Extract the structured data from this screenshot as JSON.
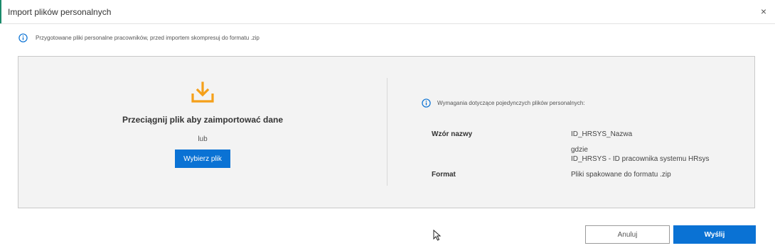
{
  "dialog": {
    "title": "Import plików personalnych",
    "close_label": "×"
  },
  "info": {
    "icon": "info-circle-icon",
    "text": "Przygotowane pliki personalne pracowników, przed importem skompresuj do formatu .zip"
  },
  "drop_zone": {
    "icon": "download-tray-icon",
    "title": "Przeciągnij plik aby zaimportować dane",
    "or_text": "lub",
    "choose_button": "Wybierz plik"
  },
  "requirements": {
    "icon": "info-circle-icon",
    "text": "Wymagania dotyczące pojedynczych plików personalnych:",
    "name_pattern_label": "Wzór nazwy",
    "name_pattern_value": "ID_HRSYS_Nazwa",
    "where_line1": "gdzie",
    "where_line2": "ID_HRSYS - ID pracownika systemu HRsys",
    "format_label": "Format",
    "format_value": "Pliki spakowane do formatu .zip"
  },
  "footer": {
    "cancel_label": "Anuluj",
    "send_label": "Wyślij"
  },
  "colors": {
    "accent": "#1a8a6b",
    "primary": "#0a72d4",
    "upload_icon": "#f5a01a",
    "info_icon": "#0a72d4"
  }
}
